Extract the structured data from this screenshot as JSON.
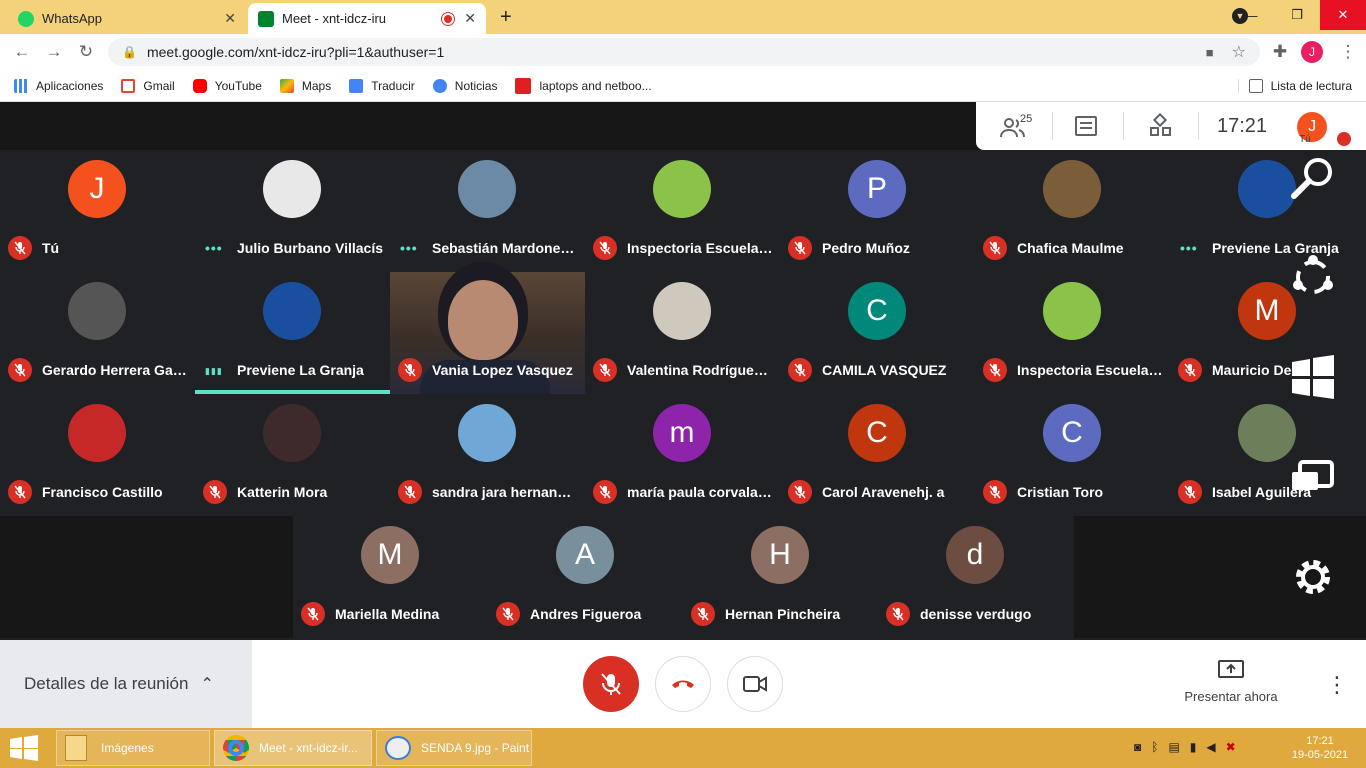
{
  "browser": {
    "tabs": [
      {
        "title": "WhatsApp",
        "active": false
      },
      {
        "title": "Meet - xnt-idcz-iru",
        "active": true
      }
    ],
    "new_tab": "+",
    "url": "meet.google.com/xnt-idcz-iru?pli=1&authuser=1",
    "profile_initial": "J",
    "bookmarks": [
      "Aplicaciones",
      "Gmail",
      "YouTube",
      "Maps",
      "Traducir",
      "Noticias",
      "laptops and netboo..."
    ],
    "reading_list": "Lista de lectura"
  },
  "meet": {
    "participants_count": "25",
    "clock": "17:21",
    "self_label": "Tú",
    "self_initial": "J",
    "rows": [
      [
        {
          "name": "Tú",
          "initial": "J",
          "color": "#f4511e",
          "muted": true
        },
        {
          "name": "Julio Burbano Villacís",
          "initial": "",
          "color": "#e8e8e8",
          "muted": false
        },
        {
          "name": "Sebastián Mardones ...",
          "initial": "",
          "color": "#6b8aa6",
          "muted": false
        },
        {
          "name": "Inspectoria Escuela P...",
          "initial": "",
          "color": "#8bc34a",
          "muted": true
        },
        {
          "name": "Pedro Muñoz",
          "initial": "P",
          "color": "#5c6bc0",
          "muted": true
        },
        {
          "name": "Chafica Maulme",
          "initial": "",
          "color": "#7b5d3a",
          "muted": true
        },
        {
          "name": "Previene La Granja",
          "initial": "",
          "color": "#1a4fa0",
          "muted": false
        }
      ],
      [
        {
          "name": "Gerardo Herrera Galla...",
          "initial": "",
          "color": "#555555",
          "muted": true
        },
        {
          "name": "Previene La Granja",
          "initial": "",
          "color": "#1a4fa0",
          "muted": false
        },
        {
          "name": "Vania Lopez Vasquez",
          "initial": "",
          "color": "#4a3b30",
          "muted": true
        },
        {
          "name": "Valentina Rodríguez ...",
          "initial": "",
          "color": "#cfc8bc",
          "muted": true
        },
        {
          "name": "CAMILA VASQUEZ",
          "initial": "C",
          "color": "#00897b",
          "muted": true
        },
        {
          "name": "Inspectoria Escuela P...",
          "initial": "",
          "color": "#8bc34a",
          "muted": true
        },
        {
          "name": "Mauricio Del...",
          "initial": "M",
          "color": "#c0360e",
          "muted": true
        }
      ],
      [
        {
          "name": "Francisco Castillo",
          "initial": "",
          "color": "#c62828",
          "muted": true
        },
        {
          "name": "Katterin Mora",
          "initial": "",
          "color": "#3e2a2a",
          "muted": true
        },
        {
          "name": "sandra jara hernandez",
          "initial": "",
          "color": "#6fa8d6",
          "muted": true
        },
        {
          "name": "maría paula corvalan ...",
          "initial": "m",
          "color": "#8e24aa",
          "muted": true
        },
        {
          "name": "Carol Aravenehj. a",
          "initial": "C",
          "color": "#c0360e",
          "muted": true
        },
        {
          "name": "Cristian Toro",
          "initial": "C",
          "color": "#5c6bc0",
          "muted": true
        },
        {
          "name": "Isabel Aguilera",
          "initial": "",
          "color": "#6d7f5a",
          "muted": true
        }
      ],
      [
        {
          "name": "Mariella Medina",
          "initial": "M",
          "color": "#8d6e63",
          "muted": true
        },
        {
          "name": "Andres Figueroa",
          "initial": "A",
          "color": "#78909c",
          "muted": true
        },
        {
          "name": "Hernan Pincheira",
          "initial": "H",
          "color": "#8d6e63",
          "muted": true
        },
        {
          "name": "denisse verdugo",
          "initial": "d",
          "color": "#6d4c41",
          "muted": true
        }
      ]
    ],
    "meeting_details": "Detalles de la reunión",
    "present_now": "Presentar ahora"
  },
  "taskbar": {
    "items": [
      "Imágenes",
      "Meet - xnt-idcz-ir...",
      "SENDA 9.jpg - Paint"
    ],
    "time": "17:21",
    "date": "19-05-2021"
  },
  "colors": {
    "tabstrip": "#f4d27a",
    "taskbar": "#e0a93d",
    "mute_red": "#d93025",
    "speaking": "#5ee0c4"
  }
}
